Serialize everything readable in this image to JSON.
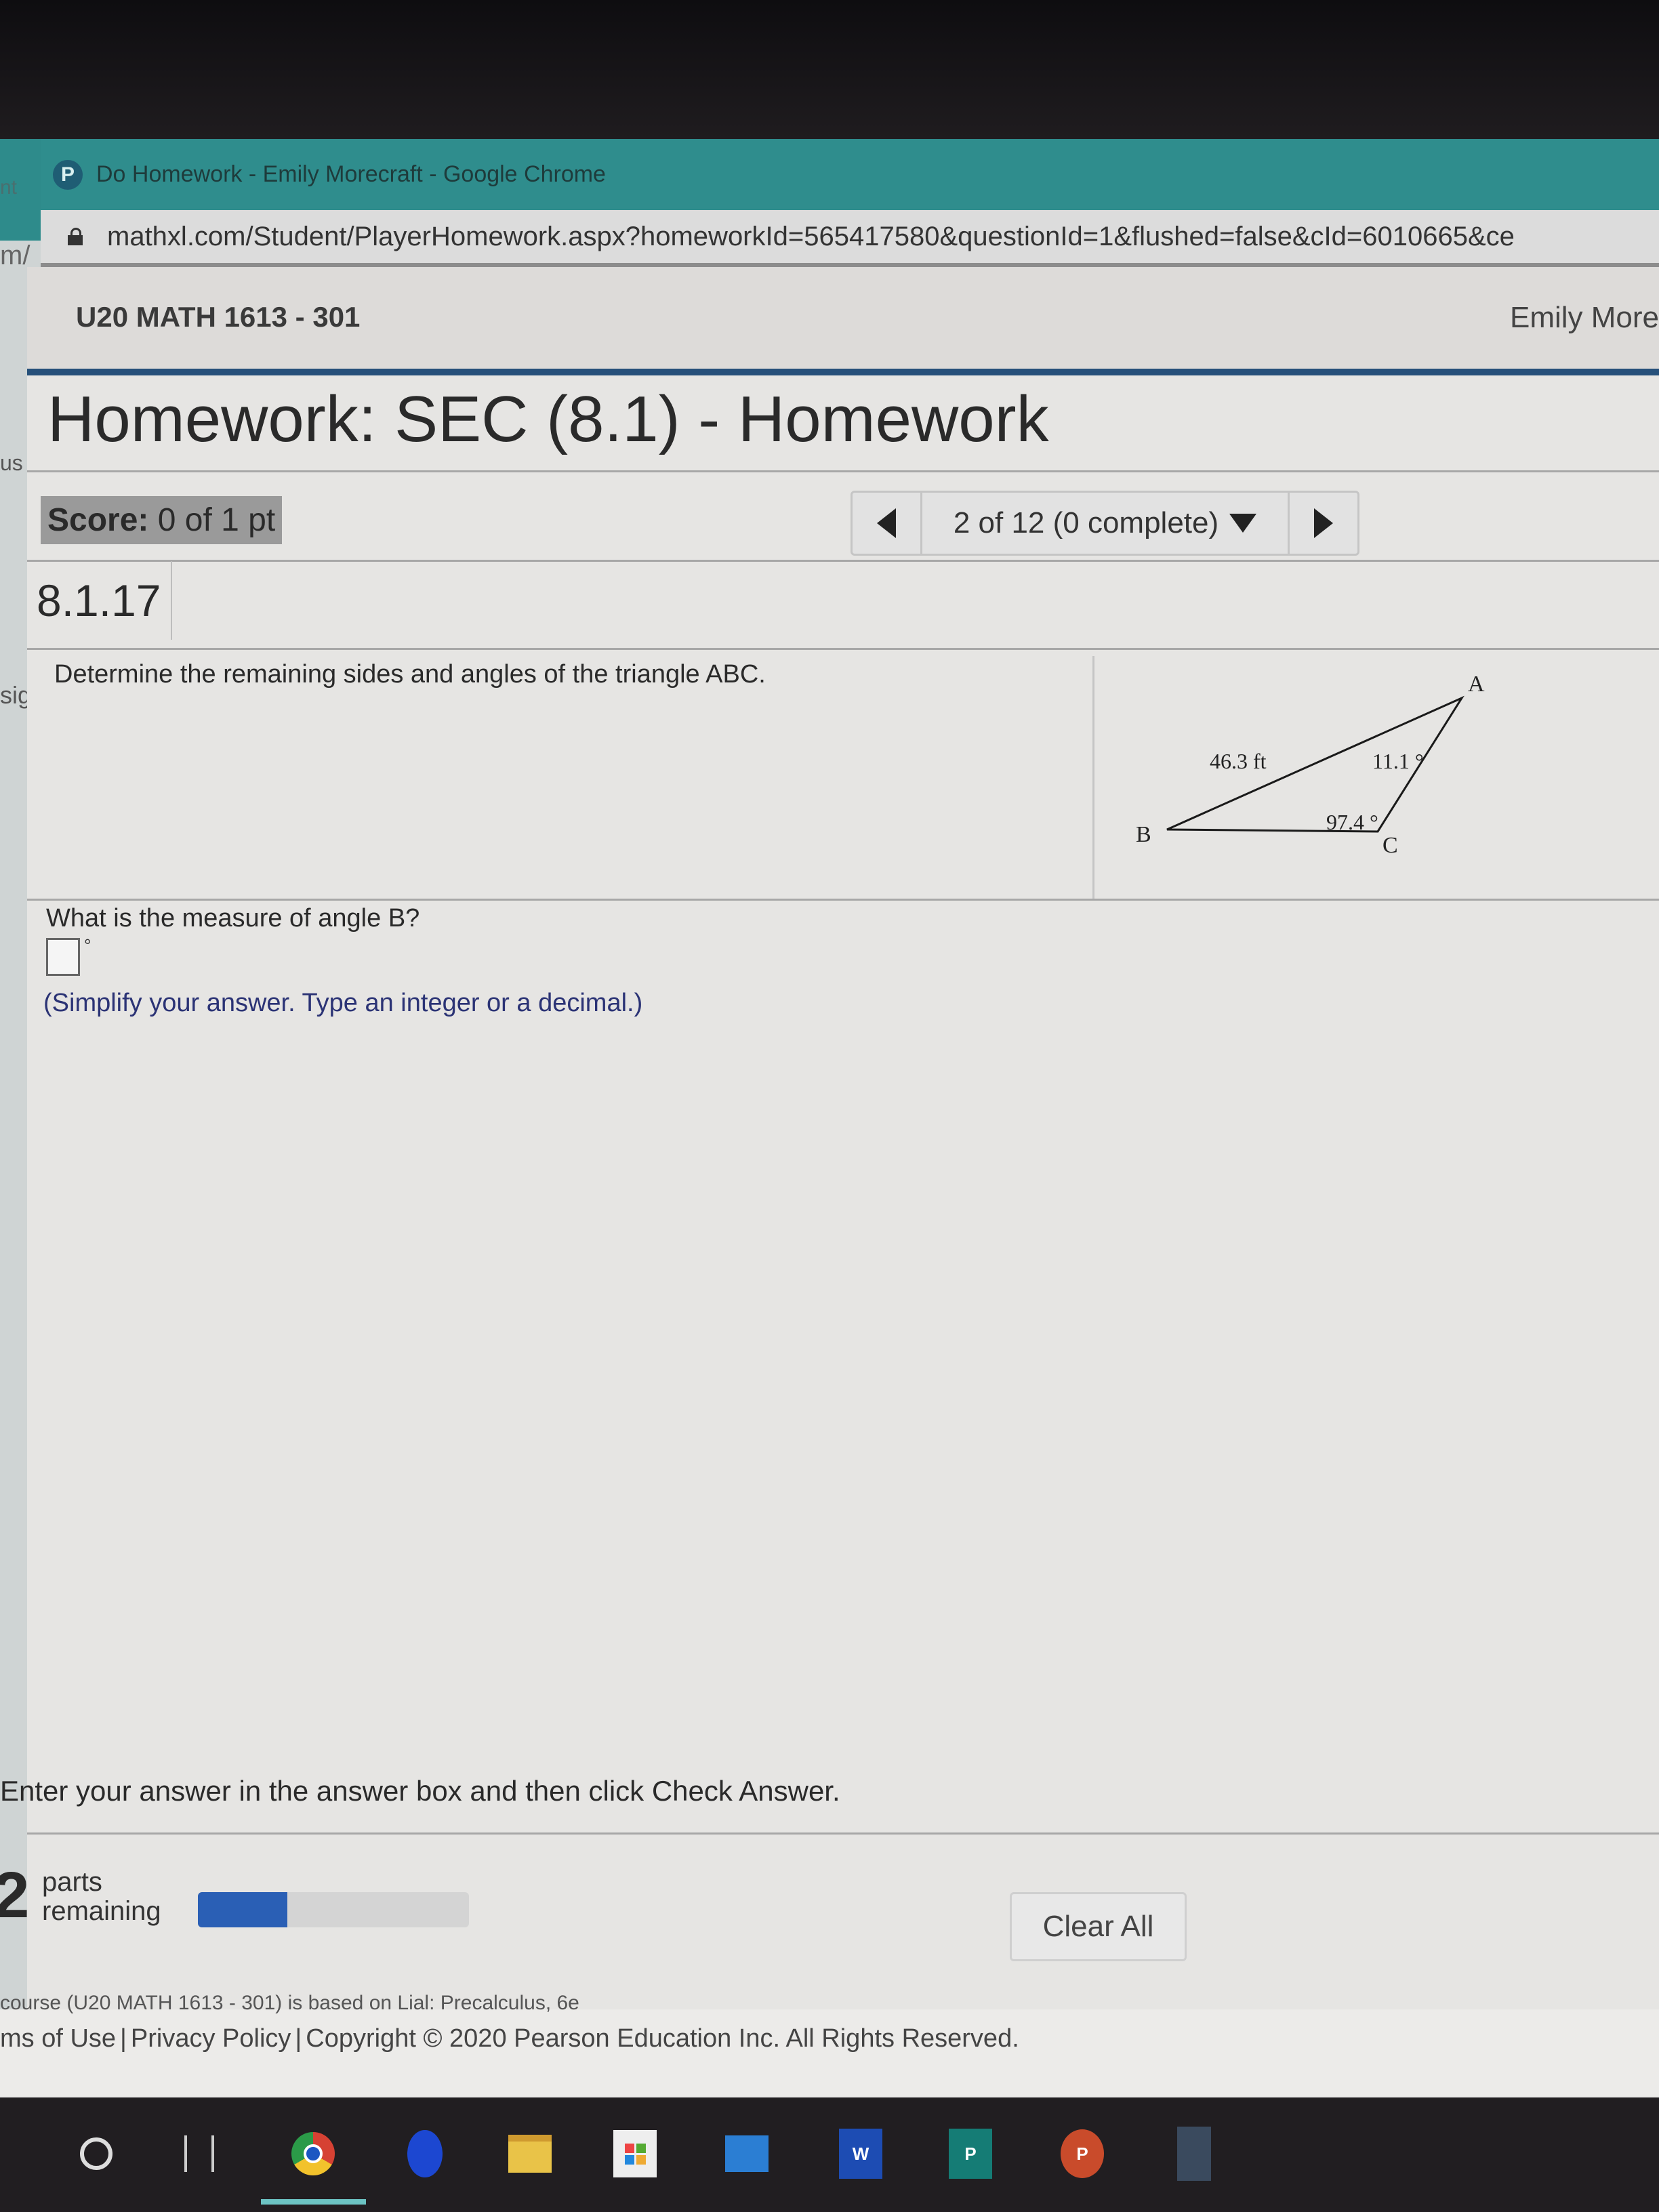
{
  "browser": {
    "window_title": "Do Homework - Emily Morecraft - Google Chrome",
    "tab_icon": "pearson-p-icon",
    "url": "mathxl.com/Student/PlayerHomework.aspx?homeworkId=565417580&questionId=1&flushed=false&cId=6010665&ce"
  },
  "left_edge_fragments": [
    "nt",
    "m/",
    "us |",
    "sig"
  ],
  "header": {
    "course": "U20 MATH 1613 - 301",
    "user": "Emily More"
  },
  "homework": {
    "title": "Homework: SEC (8.1) - Homework",
    "score_label": "Score:",
    "score_value": "0 of 1 pt",
    "nav": {
      "prev_icon": "triangle-left-icon",
      "position": "2 of 12 (0 complete)",
      "dropdown_icon": "triangle-down-icon",
      "next_icon": "triangle-right-icon"
    },
    "question_number": "8.1.17"
  },
  "problem": {
    "prompt": "Determine the remaining sides and angles of the triangle ABC.",
    "figure": {
      "vertices": [
        "A",
        "B",
        "C"
      ],
      "side_AB_label": "46.3 ft",
      "angle_A_label": "11.1 °",
      "angle_C_label": "97.4 °"
    },
    "question": "What is the measure of angle B?",
    "answer_value": "",
    "unit_symbol": "°",
    "hint": "(Simplify your answer. Type an integer or a decimal.)"
  },
  "footer_area": {
    "instruction": "Enter your answer in the answer box and then click Check Answer.",
    "parts_remaining_number": "2",
    "parts_remaining_label_1": "parts",
    "parts_remaining_label_2": "remaining",
    "progress_fraction": 0.33,
    "progress_color": "#2a5fb5",
    "clear_all": "Clear All"
  },
  "page_footer": {
    "cut_text": "course (U20 MATH 1613 - 301) is based on Lial: Precalculus, 6e",
    "terms": "ms of Use",
    "privacy": "Privacy Policy",
    "copyright": "Copyright © 2020 Pearson Education Inc. All Rights Reserved."
  },
  "taskbar": {
    "items": [
      "cortana-search",
      "task-view",
      "google-chrome",
      "microsoft-edge",
      "file-explorer",
      "microsoft-store",
      "mail",
      "word",
      "publisher",
      "powerpoint",
      "calculator"
    ],
    "word_letter": "W",
    "publisher_letter": "P",
    "powerpoint_letter": "P"
  },
  "colors": {
    "chrome_titlebar": "#2f8d8d",
    "course_rule": "#26507a",
    "hint_text": "#2b3375"
  }
}
